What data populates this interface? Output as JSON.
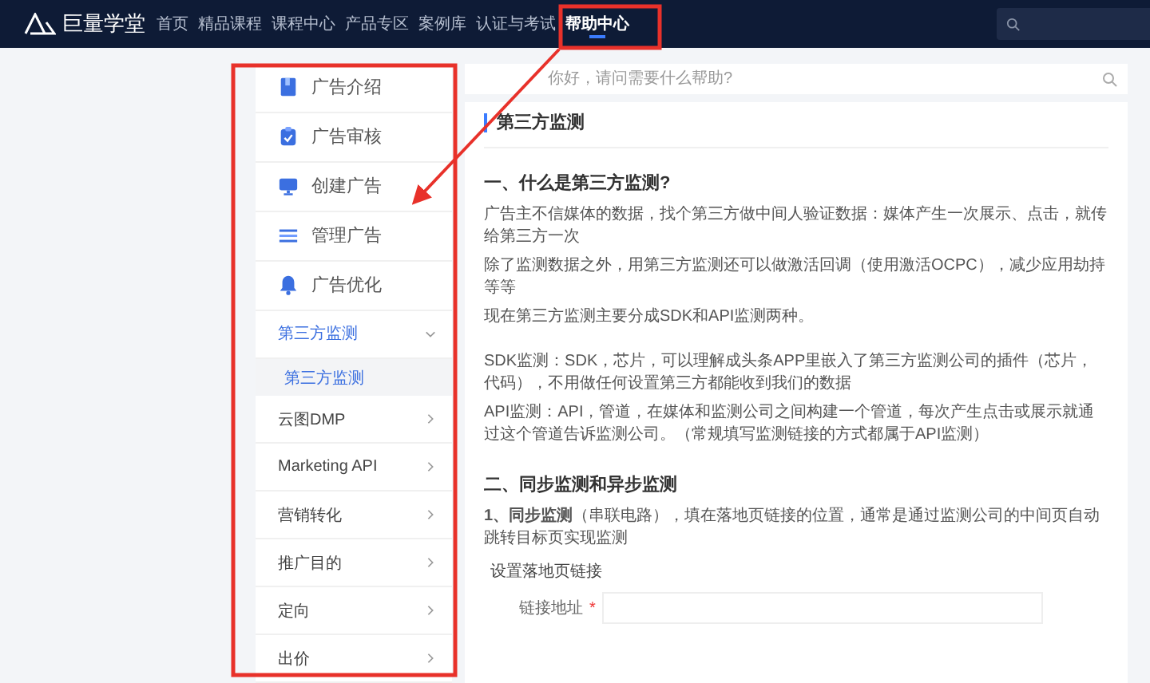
{
  "top_nav": {
    "logo": "巨量学堂",
    "items": [
      {
        "label": "首页",
        "selected": false
      },
      {
        "label": "精品课程",
        "selected": false
      },
      {
        "label": "课程中心",
        "selected": false
      },
      {
        "label": "产品专区",
        "selected": false
      },
      {
        "label": "案例库",
        "selected": false
      },
      {
        "label": "认证与考试",
        "selected": false
      },
      {
        "label": "帮助中心",
        "selected": true
      }
    ]
  },
  "sidebar": {
    "items": [
      {
        "label": "广告介绍",
        "kind": "main",
        "selected": false
      },
      {
        "label": "广告审核",
        "kind": "main",
        "selected": false
      },
      {
        "label": "创建广告",
        "kind": "main",
        "selected": false
      },
      {
        "label": "管理广告",
        "kind": "main",
        "selected": false
      },
      {
        "label": "广告优化",
        "kind": "main",
        "selected": false
      },
      {
        "label": "第三方监测",
        "kind": "group",
        "expanded": true,
        "selected": false,
        "children": [
          {
            "label": "第三方监测",
            "selected": true
          }
        ]
      },
      {
        "label": "云图DMP",
        "kind": "group",
        "expanded": false,
        "selected": false
      },
      {
        "label": "Marketing API",
        "kind": "group",
        "expanded": false,
        "selected": false
      },
      {
        "label": "营销转化",
        "kind": "group",
        "expanded": false,
        "selected": false
      },
      {
        "label": "推广目的",
        "kind": "group",
        "expanded": false,
        "selected": false
      },
      {
        "label": "定向",
        "kind": "group",
        "expanded": false,
        "selected": false
      },
      {
        "label": "出价",
        "kind": "group",
        "expanded": false,
        "selected": false
      }
    ]
  },
  "search": {
    "placeholder": "你好，请问需要什么帮助?"
  },
  "article": {
    "title": "第三方监测",
    "blocks": [
      {
        "kind": "heading",
        "text": "一、什么是第三方监测?"
      },
      {
        "kind": "paragraph",
        "text": "广告主不信媒体的数据，找个第三方做中间人验证数据：媒体产生一次展示、点击，就传给第三方一次"
      },
      {
        "kind": "paragraph",
        "text": "除了监测数据之外，用第三方监测还可以做激活回调（使用激活OCPC），减少应用劫持等等"
      },
      {
        "kind": "paragraph",
        "text": "现在第三方监测主要分成SDK和API监测两种。"
      },
      {
        "kind": "spacer"
      },
      {
        "kind": "paragraph",
        "text": "SDK监测：SDK，芯片，可以理解成头条APP里嵌入了第三方监测公司的插件（芯片，代码），不用做任何设置第三方都能收到我们的数据"
      },
      {
        "kind": "paragraph",
        "text": "API监测：API，管道，在媒体和监测公司之间构建一个管道，每次产生点击或展示就通过这个管道告诉监测公司。（常规填写监测链接的方式都属于API监测）"
      },
      {
        "kind": "spacer"
      },
      {
        "kind": "heading",
        "text": "二、同步监测和异步监测"
      },
      {
        "kind": "paragraph",
        "text": "**1、同步监测**（串联电路），填在落地页链接的位置，通常是通过监测公司的中间页自动跳转目标页实现监测"
      },
      {
        "kind": "subheading",
        "text": "设置落地页链接"
      },
      {
        "kind": "field",
        "label": "链接地址",
        "required_mark": "*"
      }
    ]
  }
}
